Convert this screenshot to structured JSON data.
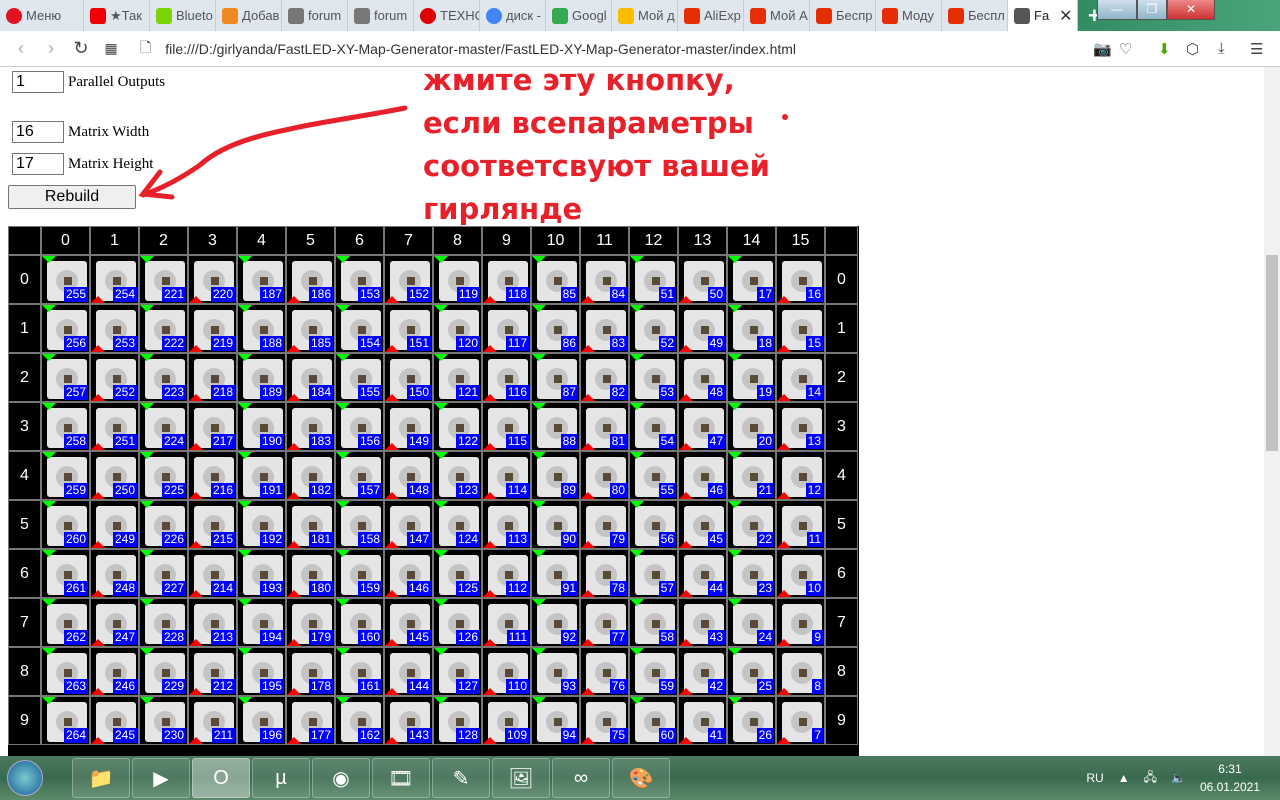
{
  "browser": {
    "tabs": [
      {
        "label": "Меню",
        "icon": "opera-icon",
        "color": "#e0141e"
      },
      {
        "label": "★Так",
        "icon": "youtube-icon",
        "color": "#e00"
      },
      {
        "label": "Blueto",
        "icon": "tools-icon",
        "color": "#7bd300"
      },
      {
        "label": "Добав",
        "icon": "orange-ball-icon",
        "color": "#f08a20"
      },
      {
        "label": "forum",
        "icon": "forum-icon",
        "color": "#777"
      },
      {
        "label": "forum",
        "icon": "forum-icon",
        "color": "#777"
      },
      {
        "label": "ТЕХНО",
        "icon": "t-icon",
        "color": "#d00"
      },
      {
        "label": "диск -",
        "icon": "google-icon",
        "color": "#4285f4"
      },
      {
        "label": "Googl",
        "icon": "drive-icon",
        "color": "#34a853"
      },
      {
        "label": "Мой д",
        "icon": "drive-icon",
        "color": "#fbbc04"
      },
      {
        "label": "AliExp",
        "icon": "aliexpress-icon",
        "color": "#e62e04"
      },
      {
        "label": "Мой А",
        "icon": "aliexpress-icon",
        "color": "#e62e04"
      },
      {
        "label": "Беспр",
        "icon": "aliexpress-icon",
        "color": "#e62e04"
      },
      {
        "label": "Моду",
        "icon": "aliexpress-icon",
        "color": "#e62e04"
      },
      {
        "label": "Беспл",
        "icon": "aliexpress-icon",
        "color": "#e62e04"
      },
      {
        "label": "Fa",
        "icon": "file-icon",
        "color": "#555",
        "active": true
      }
    ],
    "url": "file:///D:/girlyanda/FastLED-XY-Map-Generator-master/FastLED-XY-Map-Generator-master/index.html"
  },
  "form": {
    "parallel_outputs": "1",
    "parallel_outputs_label": "Parallel Outputs",
    "matrix_width": "16",
    "matrix_width_label": "Matrix Width",
    "matrix_height": "17",
    "matrix_height_label": "Matrix Height",
    "rebuild_label": "Rebuild"
  },
  "annotation": {
    "text": "жмите эту кнопку, если всепараметры соответсвуют вашей гирлянде",
    "color": "#e8202a"
  },
  "grid": {
    "columns": [
      "0",
      "1",
      "2",
      "3",
      "4",
      "5",
      "6",
      "7",
      "8",
      "9",
      "10",
      "11",
      "12",
      "13",
      "14",
      "15"
    ],
    "rows": [
      {
        "label": "0",
        "values": [
          255,
          254,
          221,
          220,
          187,
          186,
          153,
          152,
          119,
          118,
          85,
          84,
          51,
          50,
          17,
          16
        ]
      },
      {
        "label": "1",
        "values": [
          256,
          253,
          222,
          219,
          188,
          185,
          154,
          151,
          120,
          117,
          86,
          83,
          52,
          49,
          18,
          15
        ]
      },
      {
        "label": "2",
        "values": [
          257,
          252,
          223,
          218,
          189,
          184,
          155,
          150,
          121,
          116,
          87,
          82,
          53,
          48,
          19,
          14
        ]
      },
      {
        "label": "3",
        "values": [
          258,
          251,
          224,
          217,
          190,
          183,
          156,
          149,
          122,
          115,
          88,
          81,
          54,
          47,
          20,
          13
        ]
      },
      {
        "label": "4",
        "values": [
          259,
          250,
          225,
          216,
          191,
          182,
          157,
          148,
          123,
          114,
          89,
          80,
          55,
          46,
          21,
          12
        ]
      },
      {
        "label": "5",
        "values": [
          260,
          249,
          226,
          215,
          192,
          181,
          158,
          147,
          124,
          113,
          90,
          79,
          56,
          45,
          22,
          11
        ]
      },
      {
        "label": "6",
        "values": [
          261,
          248,
          227,
          214,
          193,
          180,
          159,
          146,
          125,
          112,
          91,
          78,
          57,
          44,
          23,
          10
        ]
      },
      {
        "label": "7",
        "values": [
          262,
          247,
          228,
          213,
          194,
          179,
          160,
          145,
          126,
          111,
          92,
          77,
          58,
          43,
          24,
          9
        ]
      },
      {
        "label": "8",
        "values": [
          263,
          246,
          229,
          212,
          195,
          178,
          161,
          144,
          127,
          110,
          93,
          76,
          59,
          42,
          25,
          8
        ]
      },
      {
        "label": "9",
        "values": [
          264,
          245,
          230,
          211,
          196,
          177,
          162,
          143,
          128,
          109,
          94,
          75,
          60,
          41,
          26,
          7
        ]
      }
    ],
    "input_marker_color": "#00ff00",
    "output_marker_color": "#ff0000",
    "number_bg": "#0000ff"
  },
  "taskbar": {
    "apps": [
      "explorer-icon",
      "media-player-icon",
      "opera-icon",
      "utorrent-icon",
      "tor-icon",
      "video-icon",
      "notepad-icon",
      "photos-icon",
      "arduino-icon",
      "paint-icon"
    ],
    "active_index": 2,
    "language": "RU",
    "time": "6:31",
    "date": "06.01.2021"
  }
}
